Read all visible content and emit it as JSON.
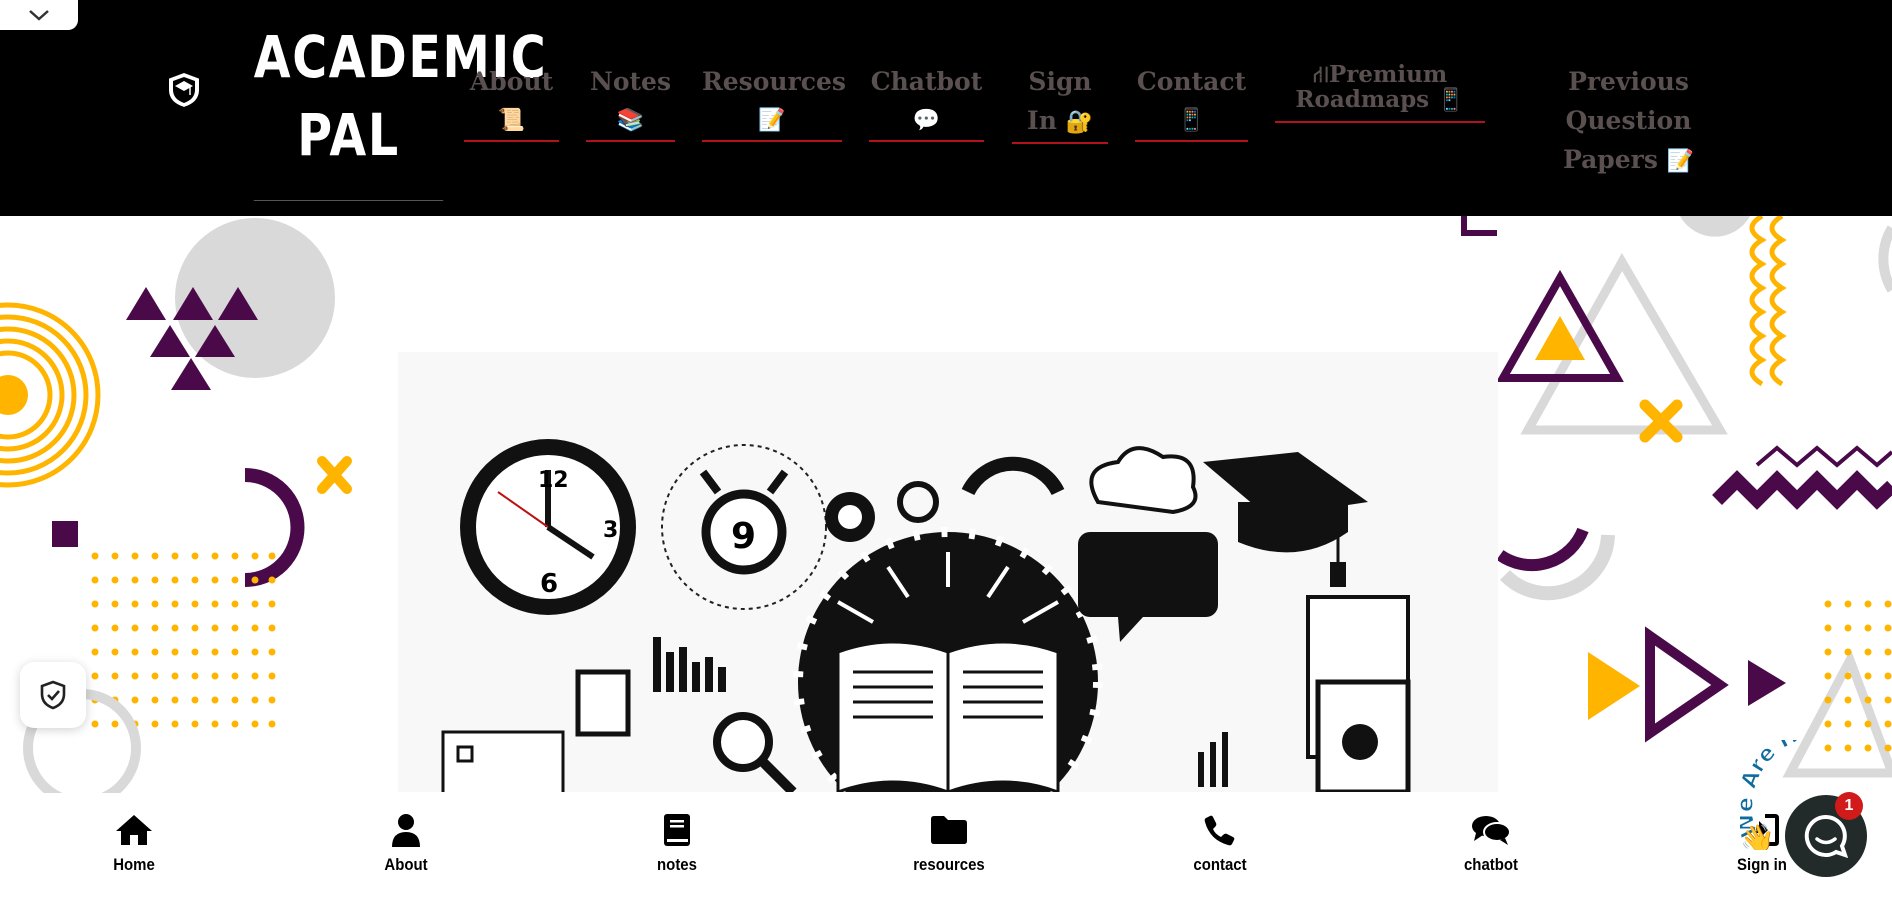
{
  "brand": {
    "line1": "ACADEMIC",
    "line2": "PAL"
  },
  "nav": {
    "about": {
      "label": "About",
      "emoji": "📜"
    },
    "notes": {
      "label": "Notes",
      "emoji": "📚"
    },
    "resources": {
      "label": "Resources",
      "emoji": "📝"
    },
    "chatbot": {
      "label": "Chatbot",
      "emoji": "💬"
    },
    "signin": {
      "label1": "Sign",
      "label2": "In",
      "emoji": "🔐"
    },
    "contact": {
      "label": "Contact",
      "emoji": "📱"
    },
    "premium": {
      "line1": "Premium",
      "line2": "Roadmaps",
      "emoji": "📱"
    },
    "pyq": {
      "line1": "Previous Question",
      "line2": "Papers",
      "emoji": "📝"
    }
  },
  "bottom_nav": [
    {
      "label": "Home",
      "icon": "home-icon"
    },
    {
      "label": "About",
      "icon": "user-icon"
    },
    {
      "label": "notes",
      "icon": "book-icon"
    },
    {
      "label": "resources",
      "icon": "folder-icon"
    },
    {
      "label": "contact",
      "icon": "phone-icon"
    },
    {
      "label": "chatbot",
      "icon": "comments-icon"
    },
    {
      "label": "Sign in",
      "icon": "sign-in-icon"
    }
  ],
  "chat": {
    "banner": "We Are Here!",
    "badge_count": "1"
  },
  "colors": {
    "purple": "#4a0a4a",
    "yellow": "#ffb400",
    "gray": "#d9d9d9",
    "accent_red": "#b1121b"
  }
}
